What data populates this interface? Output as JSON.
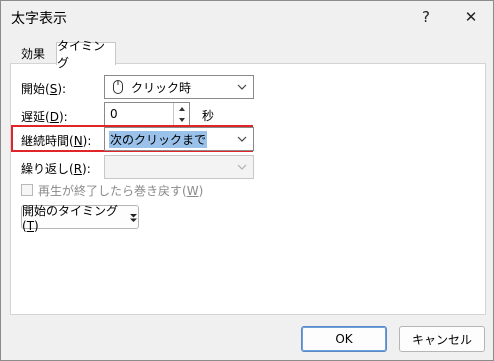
{
  "window": {
    "title": "太字表示",
    "help_label": "?",
    "close_label": "✕"
  },
  "tabs": [
    {
      "label": "効果",
      "active": false
    },
    {
      "label": "タイミング",
      "active": true
    }
  ],
  "fields": {
    "start": {
      "label_pre": "開始(",
      "accel": "S",
      "label_post": "):",
      "value": "クリック時",
      "icon": "mouse-icon"
    },
    "delay": {
      "label_pre": "遅延(",
      "accel": "D",
      "label_post": "):",
      "value": "0",
      "unit": "秒"
    },
    "duration": {
      "label_pre": "継続時間(",
      "accel": "N",
      "label_post": "):",
      "value": "次のクリックまで",
      "highlight_color": "#e0242a"
    },
    "repeat": {
      "label_pre": "繰り返し(",
      "accel": "R",
      "label_post": "):",
      "value": ""
    }
  },
  "rewind_checkbox": {
    "label_pre": "再生が終了したら巻き戻す(",
    "accel": "W",
    "label_post": ")",
    "checked": false
  },
  "triggers_button": {
    "label_pre": "開始のタイミング(",
    "accel": "T",
    "label_post": ")"
  },
  "footer": {
    "ok_label": "OK",
    "cancel_label": "キャンセル"
  },
  "colors": {
    "accent": "#5a88c8",
    "highlight_border": "#e0242a",
    "selection": "#99c1ea"
  }
}
